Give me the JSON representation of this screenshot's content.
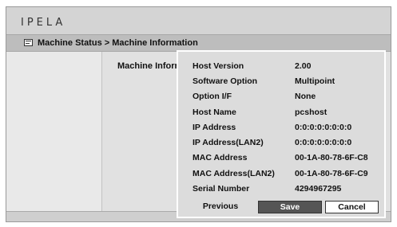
{
  "app": {
    "logo_text": "IPELA"
  },
  "header": {
    "breadcrumb": "Machine Status > Machine Information"
  },
  "main": {
    "section_label": "Machine Inforr"
  },
  "dialog": {
    "rows": [
      {
        "label": "Host Version",
        "value": "2.00"
      },
      {
        "label": "Software Option",
        "value": "Multipoint"
      },
      {
        "label": "Option I/F",
        "value": "None"
      },
      {
        "label": "Host Name",
        "value": "pcshost"
      },
      {
        "label": "IP Address",
        "value": "0:0:0:0:0:0:0:0"
      },
      {
        "label": "IP Address(LAN2)",
        "value": "0:0:0:0:0:0:0:0"
      },
      {
        "label": "MAC Address",
        "value": "00-1A-80-78-6F-C8"
      },
      {
        "label": "MAC Address(LAN2)",
        "value": "00-1A-80-78-6F-C9"
      },
      {
        "label": "Serial Number",
        "value": "4294967295"
      }
    ],
    "buttons": {
      "previous": "Previous",
      "save": "Save",
      "cancel": "Cancel"
    }
  }
}
